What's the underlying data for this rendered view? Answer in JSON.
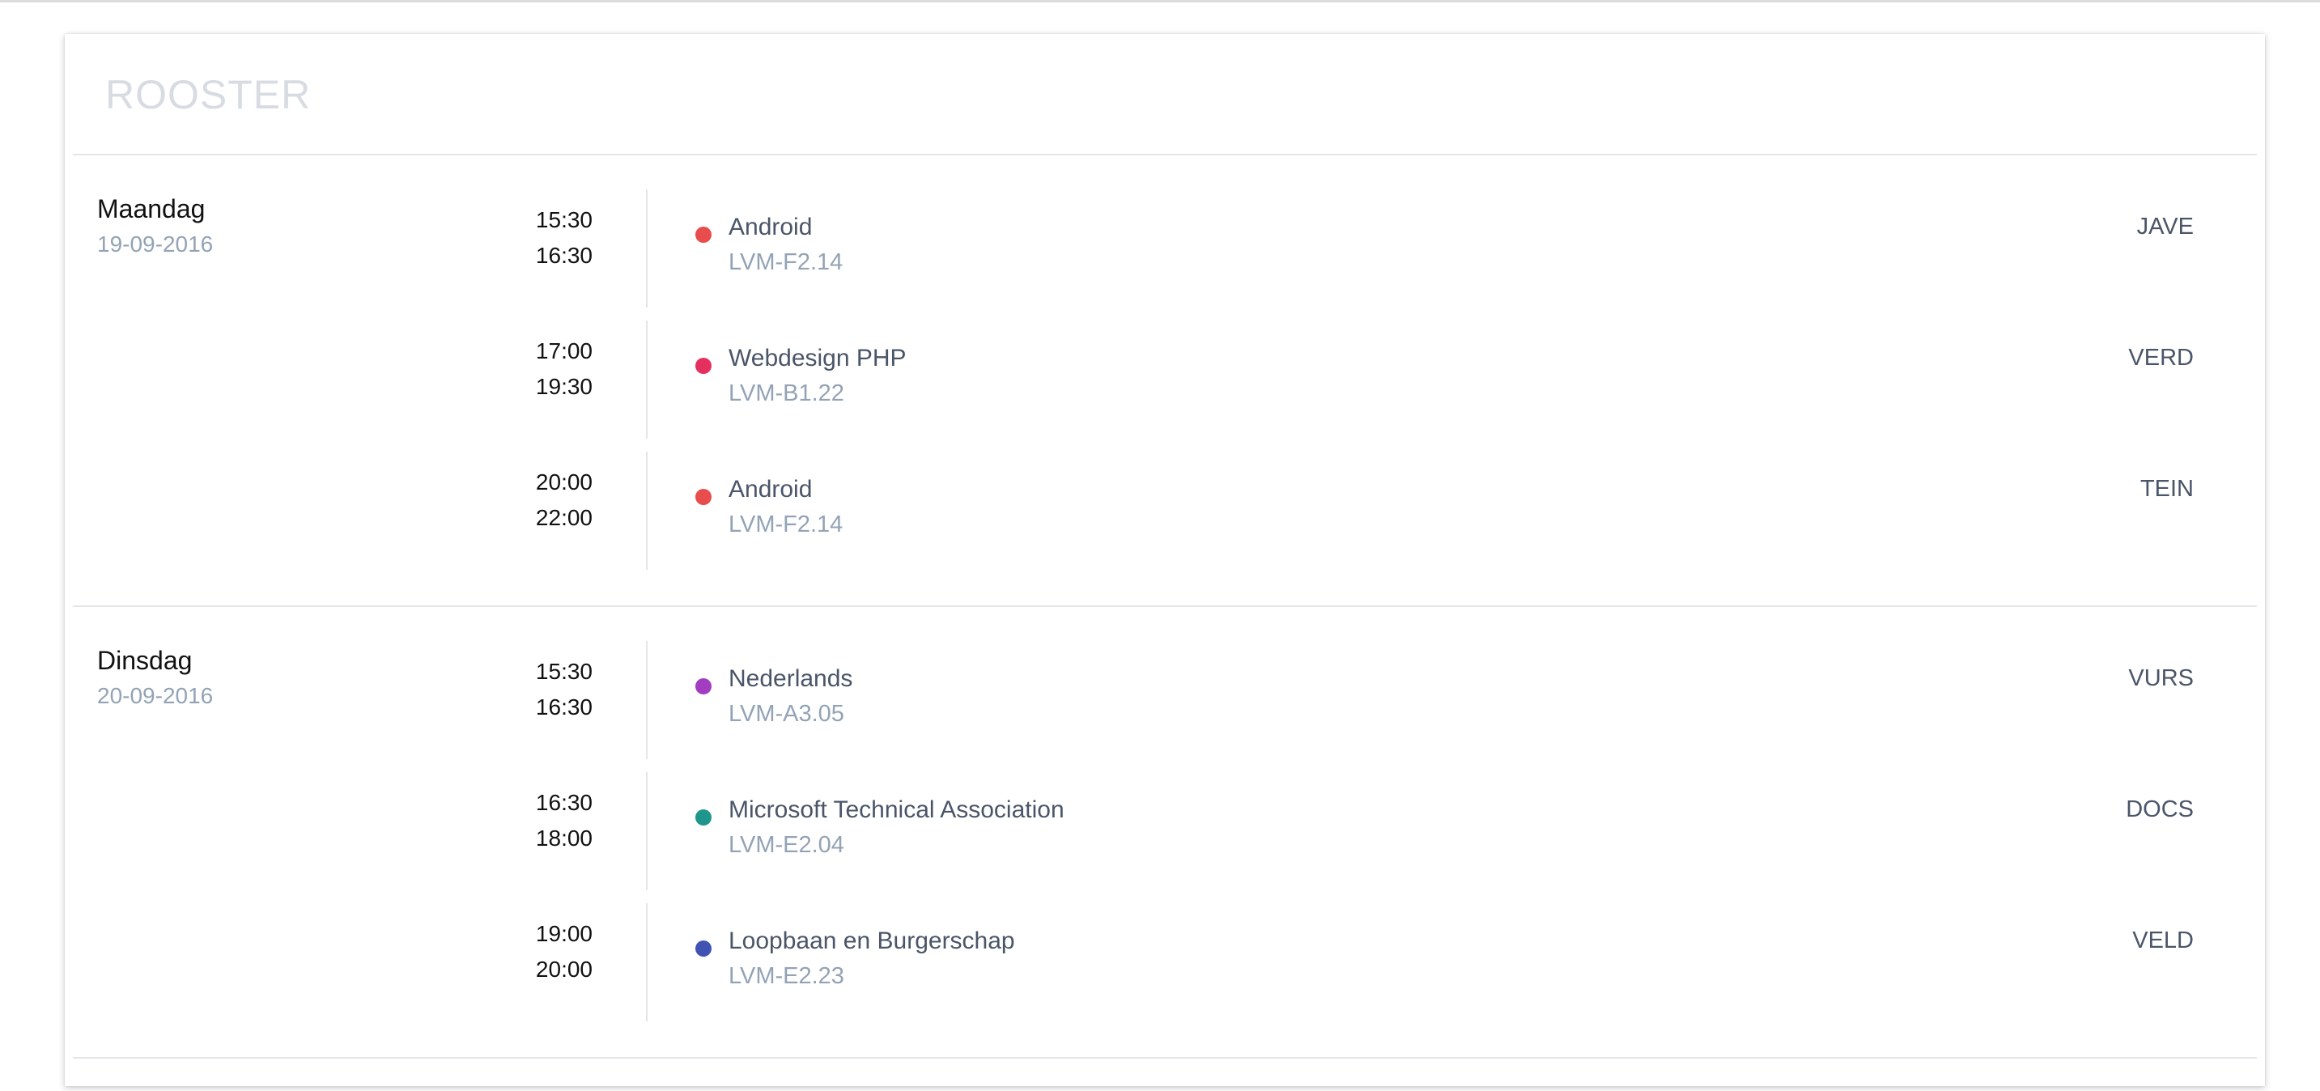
{
  "title": "ROOSTER",
  "days": [
    {
      "name": "Maandag",
      "date": "19-09-2016",
      "lessons": [
        {
          "start": "15:30",
          "end": "16:30",
          "subject": "Android",
          "room": "LVM-F2.14",
          "teacher": "JAVE",
          "color": "#e84c4c"
        },
        {
          "start": "17:00",
          "end": "19:30",
          "subject": "Webdesign PHP",
          "room": "LVM-B1.22",
          "teacher": "VERD",
          "color": "#e5305f"
        },
        {
          "start": "20:00",
          "end": "22:00",
          "subject": "Android",
          "room": "LVM-F2.14",
          "teacher": "TEIN",
          "color": "#e84c4c"
        }
      ]
    },
    {
      "name": "Dinsdag",
      "date": "20-09-2016",
      "lessons": [
        {
          "start": "15:30",
          "end": "16:30",
          "subject": "Nederlands",
          "room": "LVM-A3.05",
          "teacher": "VURS",
          "color": "#a23dbf"
        },
        {
          "start": "16:30",
          "end": "18:00",
          "subject": "Microsoft Technical Association",
          "room": "LVM-E2.04",
          "teacher": "DOCS",
          "color": "#1f968b"
        },
        {
          "start": "19:00",
          "end": "20:00",
          "subject": "Loopbaan en Burgerschap",
          "room": "LVM-E2.23",
          "teacher": "VELD",
          "color": "#4053b5"
        }
      ]
    }
  ]
}
